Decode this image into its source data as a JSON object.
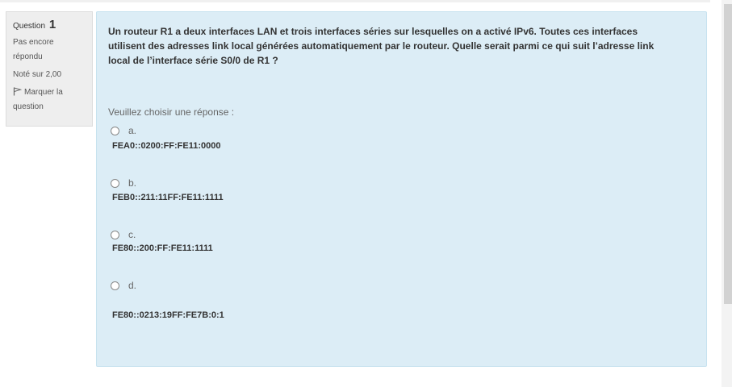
{
  "info": {
    "question_label": "Question",
    "question_number": "1",
    "state": "Pas encore répondu",
    "grade": "Noté sur 2,00",
    "flag_label": "Marquer la question"
  },
  "question": {
    "text": "Un routeur R1 a deux interfaces LAN et trois interfaces séries sur lesquelles on a activé IPv6. Toutes ces interfaces utilisent des adresses link local générées automatiquement par le routeur. Quelle serait parmi ce qui suit l’adresse link local de l’interface série S0/0 de R1 ?",
    "prompt": "Veuillez choisir une réponse :",
    "answers": [
      {
        "letter": "a.",
        "text": "FEA0::0200:FF:FE11:0000"
      },
      {
        "letter": "b.",
        "text": "FEB0::211:11FF:FE11:1111"
      },
      {
        "letter": "c.",
        "text": "FE80::200:FF:FE11:1111"
      },
      {
        "letter": "d.",
        "text": "FE80::0213:19FF:FE7B:0:1"
      }
    ]
  },
  "colors": {
    "content_bg": "#dcedf6",
    "info_bg": "#eeeeee"
  },
  "icons": {
    "flag": "flag-icon"
  }
}
